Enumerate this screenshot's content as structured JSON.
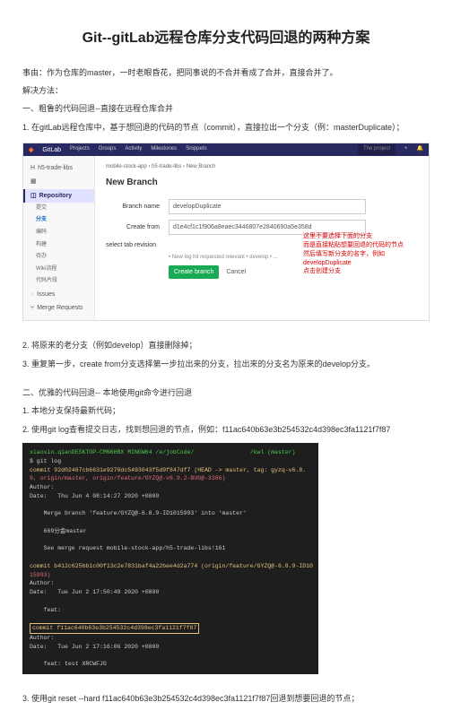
{
  "title": "Git--gitLab远程仓库分支代码回退的两种方案",
  "intro": "事由：作为仓库的master，一时老眼昏花，把同事说的不合并看成了合并，直接合并了。",
  "solution_label": "解决方法：",
  "method1_title": "一、粗鲁的代码回退--直接在远程仓库合并",
  "method1_step1": "1. 在gitLab远程仓库中，基于想回退的代码的节点（commit），直接拉出一个分支（例：masterDuplicate）；",
  "gitlab": {
    "logo": "GitLab",
    "nav": [
      "Projects",
      "Groups",
      "Activity",
      "Milestones",
      "Snippets"
    ],
    "search_placeholder": "The project",
    "sidebar": {
      "project": "h5-trade-libs",
      "items": [
        {
          "label": "Repository",
          "active": true
        },
        {
          "label": "Issues"
        },
        {
          "label": "Merge Requests"
        }
      ],
      "subitems": [
        "提交",
        "分支",
        "编码",
        "构建",
        "待办",
        "Wiki流程",
        "代码片段"
      ]
    },
    "breadcrumb": "mobile-stock-app › h5-trade-libs › New Branch",
    "page_title": "New Branch",
    "form": {
      "branch_label": "Branch name",
      "branch_value": "developDuplicate",
      "from_label": "Create from",
      "from_value": "d1e4cf1c1f906a8eaec3446807e2840690a5e358d",
      "select_label": "select tab revision",
      "hint": "• New log hit requested relevant\n• develop\n• ...",
      "create_btn": "Create branch",
      "cancel_btn": "Cancel"
    },
    "annotation": {
      "l1": "这里不要选择下面的分支",
      "l2": "而是直接粘贴想要回退的代码的节点",
      "l3": "然后填写新分支的名字，例如developDuplicate",
      "l4": "点击创建分支"
    }
  },
  "method1_step2": "2. 将原来的老分支（例如develop）直接删除掉；",
  "method1_step3": "3. 重复第一步，create from分支选择第一步拉出来的分支，拉出来的分支名为原来的develop分支。",
  "method2_title": "二、优雅的代码回退-- 本地使用git命令进行回退",
  "method2_step1": "1. 本地分支保持最新代码；",
  "method2_step2": "2. 使用git log查看提交日志，找到想回退的节点，例如：f11ac640b63e3b254532c4d398ec3fa1121f7f87",
  "terminal": {
    "prompt": "xiaoxin.qianDESKTOP-CMN6HBX MINGW64 /e/jobCode/                /kwl (master)",
    "cmd": "$ git log",
    "lines": [
      {
        "c": "yellow",
        "t": "commit 92d02487cb6631e9270dc5493043f5d9f847df7 (HEAD -> master, tag: gyzq-v6.8."
      },
      {
        "c": "red",
        "t": "9, origin/master, origin/feature/GYZQ@-v6.9.2-BUG@-3386)"
      },
      {
        "c": "",
        "t": "Author:                              "
      },
      {
        "c": "",
        "t": "Date:   Thu Jun 4 08:14:27 2020 +0800"
      },
      {
        "c": "",
        "t": ""
      },
      {
        "c": "",
        "t": "    Merge branch 'feature/GYZQ@-6.8.9-ID1015993' into 'master'"
      },
      {
        "c": "",
        "t": ""
      },
      {
        "c": "",
        "t": "    669分金master"
      },
      {
        "c": "",
        "t": ""
      },
      {
        "c": "",
        "t": "    See merge request mobile-stock-app/h5-trade-libs!161"
      },
      {
        "c": "",
        "t": ""
      },
      {
        "c": "yellow",
        "t": "commit b412c625bb1c00f13c2e7831baf4a22bee4d2a774 (origin/feature/GYZQ@-6.8.9-ID10"
      },
      {
        "c": "red",
        "t": "15993)"
      },
      {
        "c": "",
        "t": "Author:                              "
      },
      {
        "c": "",
        "t": "Date:   Tue Jun 2 17:50:49 2020 +0800"
      },
      {
        "c": "",
        "t": ""
      },
      {
        "c": "",
        "t": "    feat:            "
      },
      {
        "c": "",
        "t": ""
      },
      {
        "c": "hl",
        "t": "commit f11ac640b63e3b254532c4d398ec3fa1121f7f87"
      },
      {
        "c": "",
        "t": "Author:                              "
      },
      {
        "c": "",
        "t": "Date:   Tue Jun 2 17:16:06 2020 +0800"
      },
      {
        "c": "",
        "t": ""
      },
      {
        "c": "",
        "t": "    feat: test XRCWFJG"
      }
    ]
  },
  "method2_step3": "3. 使用git reset --hard f11ac640b63e3b254532c4d398ec3fa1121f7f87回退到想要回退的节点；"
}
